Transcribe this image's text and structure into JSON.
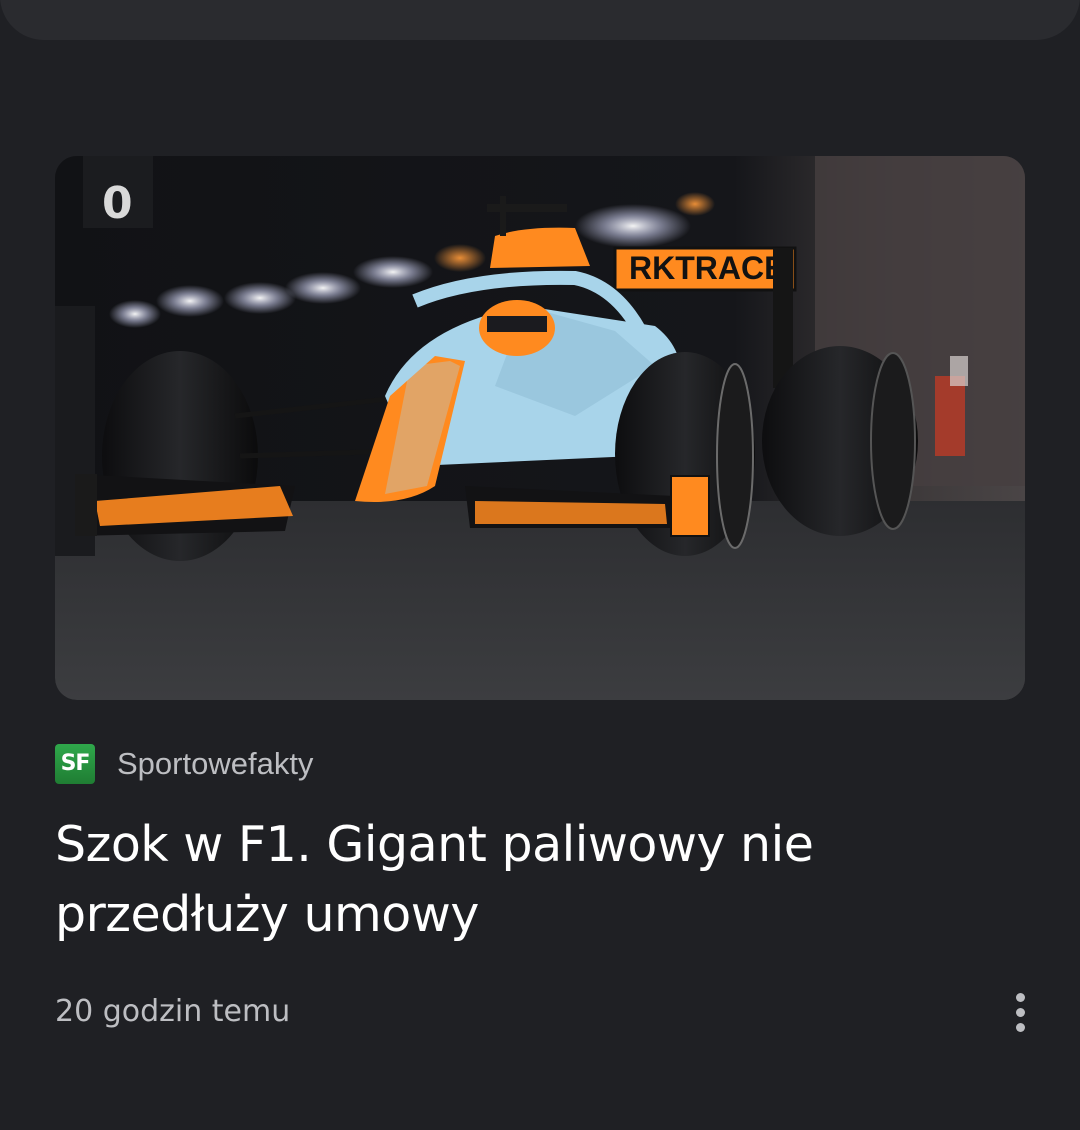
{
  "article": {
    "image": {
      "subject": "McLaren F1 car in Gulf livery racing in tunnel",
      "rear_wing_text": "RKTRACE",
      "sign_text": "0"
    },
    "source": {
      "logo_text": "SF",
      "name": "Sportowefakty"
    },
    "headline": "Szok w F1. Gigant paliwowy nie przedłuży umowy",
    "timestamp": "20 godzin temu",
    "more_icon": "more-vert-icon"
  },
  "colors": {
    "background": "#1f2024",
    "card_top": "#2a2b2f",
    "headline": "#ffffff",
    "secondary_text": "#bdbec2",
    "source_logo": "#2fa84b",
    "car_blue": "#a8d4ea",
    "car_orange": "#ff8a1f"
  }
}
